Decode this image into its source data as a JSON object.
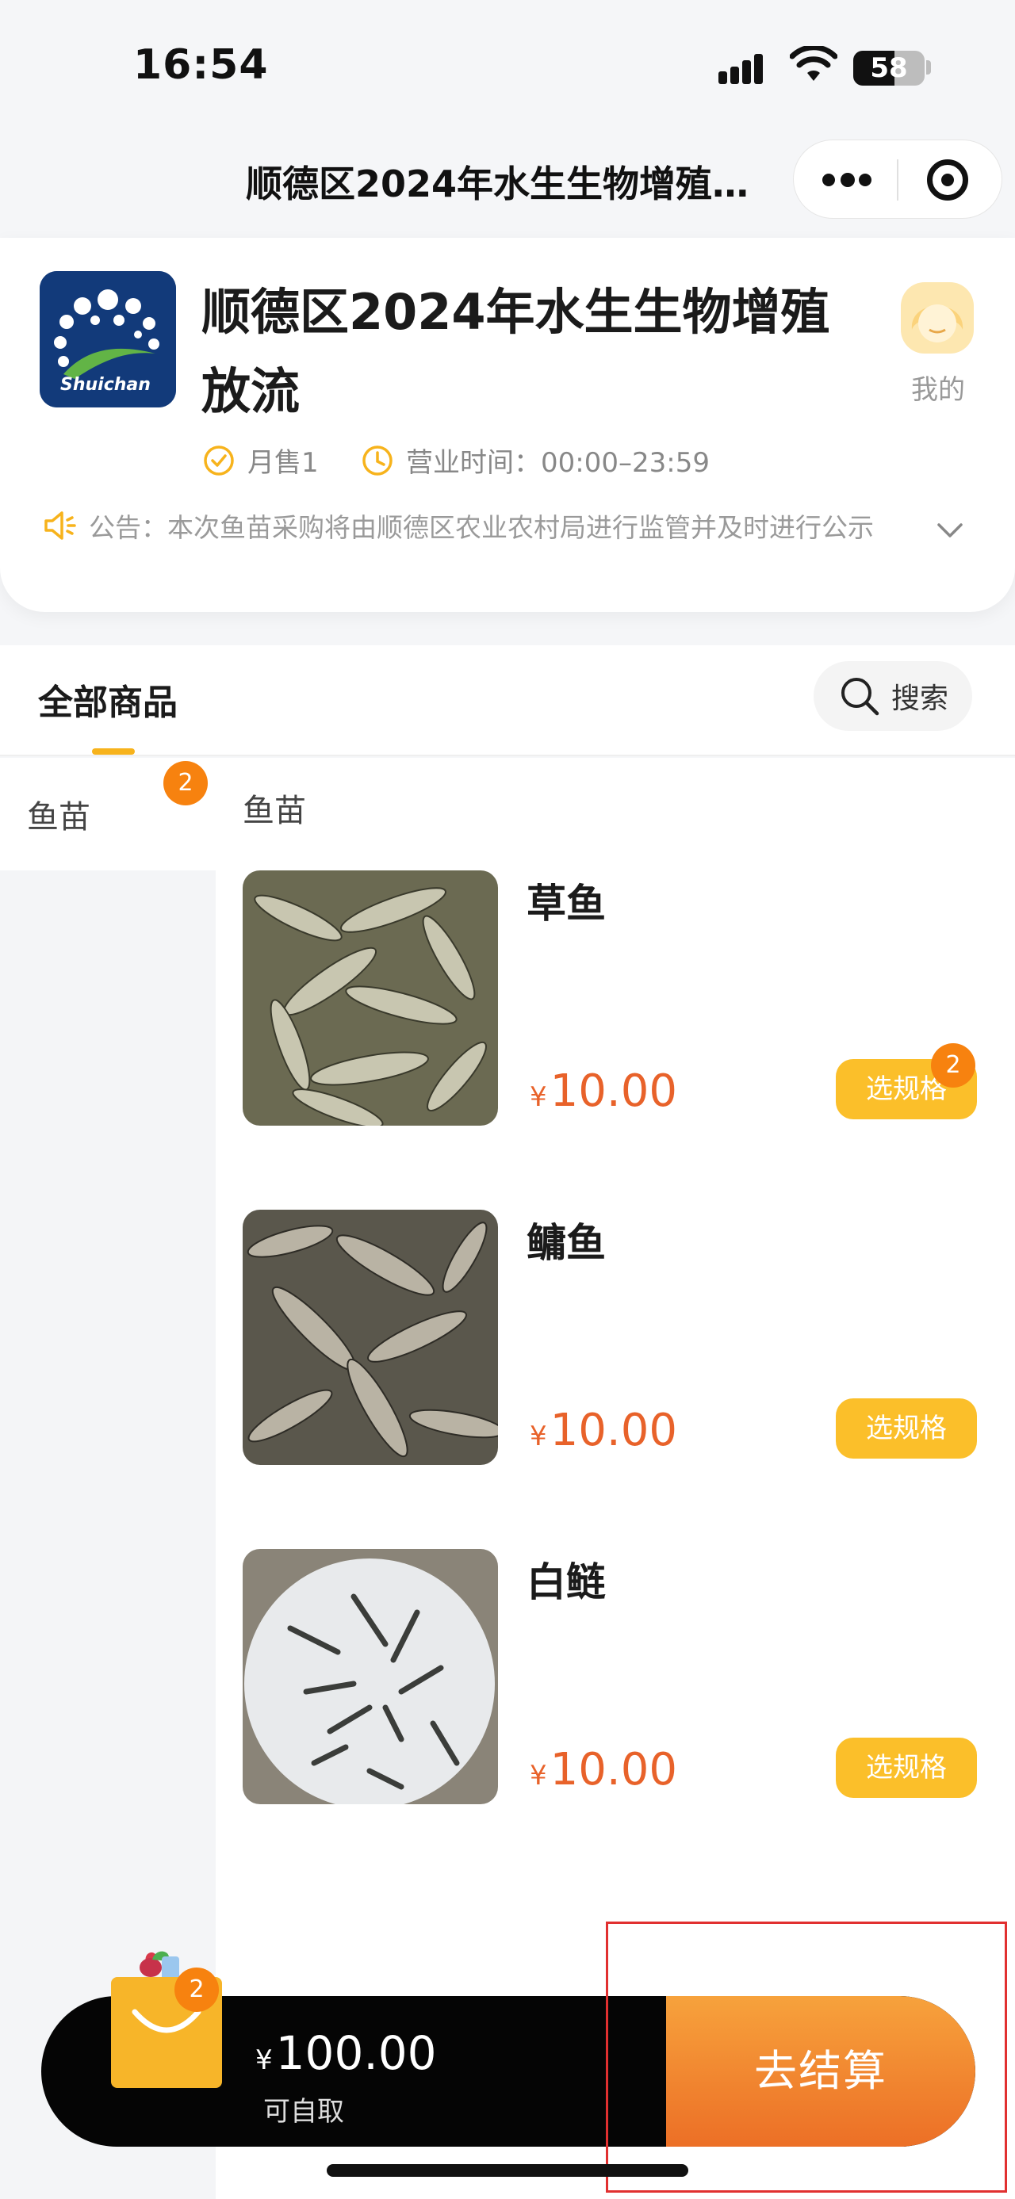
{
  "status_bar": {
    "time": "16:54",
    "battery": "58"
  },
  "nav": {
    "title": "顺德区2024年水生生物增殖放流"
  },
  "shop": {
    "name": "顺德区2024年水生生物增殖放流",
    "logo_text": "Shuichan",
    "mine_label": "我的",
    "monthly_sales": "月售1",
    "hours": "营业时间：00:00–23:59",
    "notice": "公告：本次鱼苗采购将由顺德区农业农村局进行监管并及时进行公示"
  },
  "tabs": {
    "all_label": "全部商品",
    "search_label": "搜索"
  },
  "categories": [
    {
      "label": "鱼苗",
      "badge": "2"
    }
  ],
  "section_title": "鱼苗",
  "products": [
    {
      "name": "草鱼",
      "currency": "¥",
      "price": "10.00",
      "button": "选规格",
      "badge": "2"
    },
    {
      "name": "鳙鱼",
      "currency": "¥",
      "price": "10.00",
      "button": "选规格",
      "badge": ""
    },
    {
      "name": "白鲢",
      "currency": "¥",
      "price": "10.00",
      "button": "选规格",
      "badge": ""
    }
  ],
  "cart": {
    "currency": "¥",
    "total": "100.00",
    "badge": "2",
    "pickup": "可自取",
    "checkout": "去结算"
  },
  "colors": {
    "accent": "#fbbf2a",
    "price": "#e8622a",
    "badge": "#f7820f",
    "checkout_start": "#f7a23c",
    "checkout_end": "#ec6f26"
  },
  "icons": [
    "more-dots-icon",
    "close-mini-program-icon",
    "avatar-icon",
    "check-circle-icon",
    "clock-icon",
    "speaker-icon",
    "chevron-down-icon",
    "search-icon",
    "shopping-bag-icon"
  ]
}
